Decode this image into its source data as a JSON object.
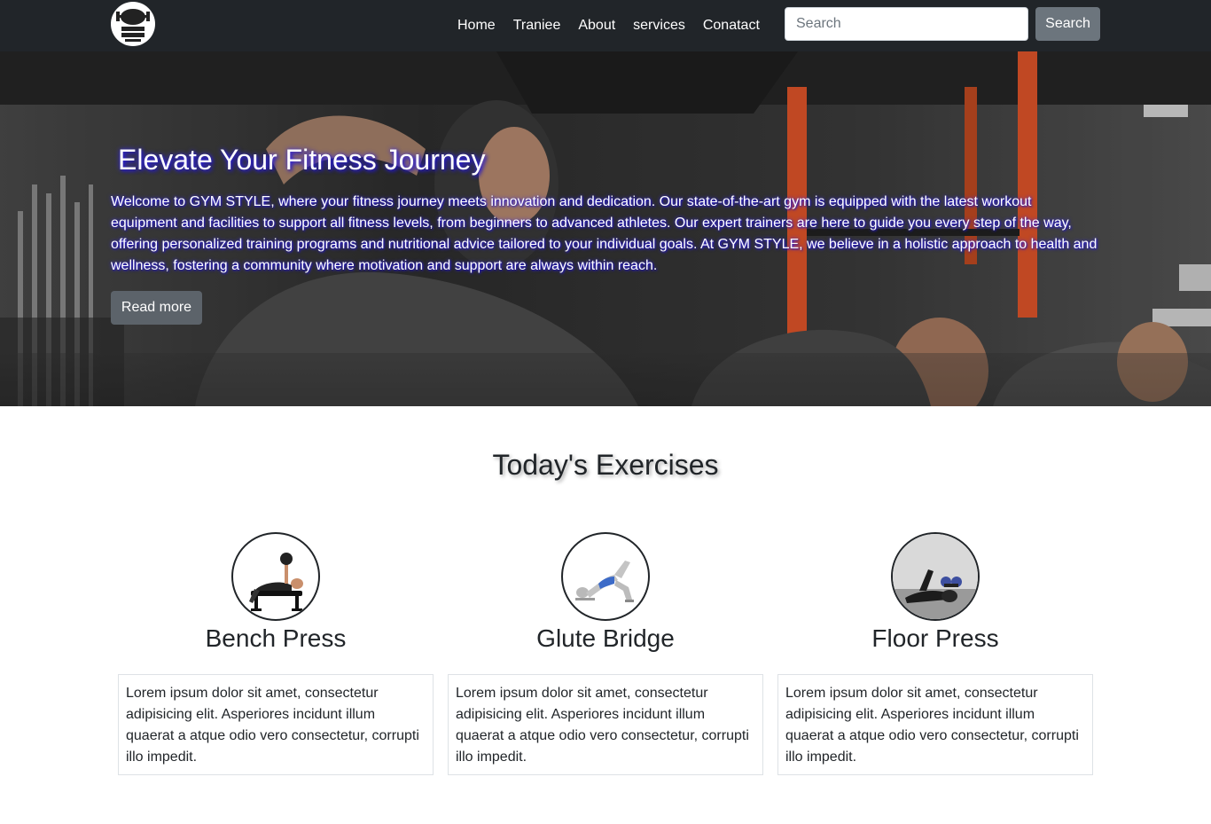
{
  "navbar": {
    "logo_icon": "gym-logo-icon",
    "links": [
      "Home",
      "Traniee",
      "About",
      "services",
      "Conatact"
    ],
    "search_placeholder": "Search",
    "search_button": "Search"
  },
  "hero": {
    "title": "Elevate Your Fitness Journey",
    "text": "Welcome to GYM STYLE, where your fitness journey meets innovation and dedication. Our state-of-the-art gym is equipped with the latest workout equipment and facilities to support all fitness levels, from beginners to advanced athletes. Our expert trainers are here to guide you every step of the way, offering personalized training programs and nutritional advice tailored to your individual goals. At GYM STYLE, we believe in a holistic approach to health and wellness, fostering a community where motivation and support are always within reach.",
    "button": "Read more"
  },
  "exercises": {
    "title": "Today's Exercises",
    "items": [
      {
        "name": "Bench Press",
        "description": "Lorem ipsum dolor sit amet, consectetur adipisicing elit. Asperiores incidunt illum quaerat a atque odio vero consectetur, corrupti illo impedit.",
        "icon": "bench-press-icon"
      },
      {
        "name": "Glute Bridge",
        "description": "Lorem ipsum dolor sit amet, consectetur adipisicing elit. Asperiores incidunt illum quaerat a atque odio vero consectetur, corrupti illo impedit.",
        "icon": "glute-bridge-icon"
      },
      {
        "name": "Floor Press",
        "description": "Lorem ipsum dolor sit amet, consectetur adipisicing elit. Asperiores incidunt illum quaerat a atque odio vero consectetur, corrupti illo impedit.",
        "icon": "floor-press-icon"
      }
    ]
  }
}
